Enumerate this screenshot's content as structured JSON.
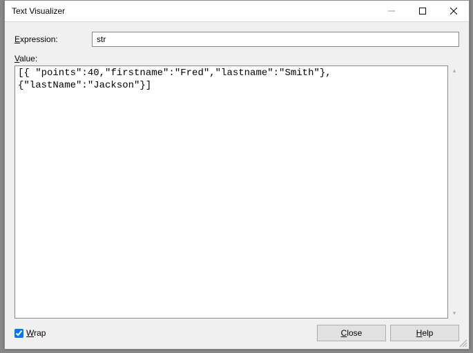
{
  "window": {
    "title": "Text Visualizer"
  },
  "labels": {
    "expression": "Expression:",
    "value": "Value:",
    "wrap": "Wrap"
  },
  "expression": {
    "value": "str"
  },
  "text": {
    "content": "[{ \"points\":40,\"firstname\":\"Fred\",\"lastname\":\"Smith\"},\n{\"lastName\":\"Jackson\"}]"
  },
  "wrap_checked": true,
  "buttons": {
    "close": "Close",
    "help": "Help"
  }
}
